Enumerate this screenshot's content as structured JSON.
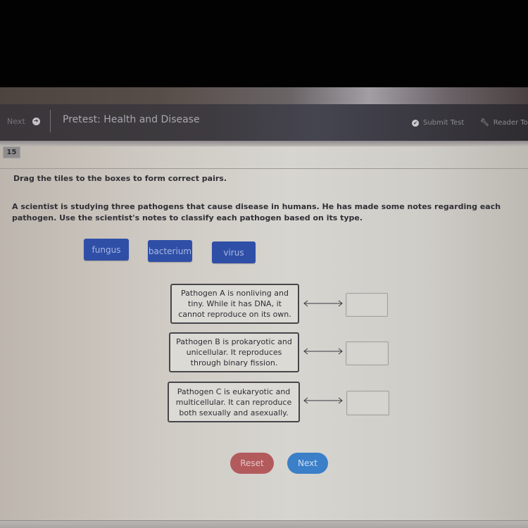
{
  "header": {
    "nav_next_label": "Next",
    "title": "Pretest: Health and Disease",
    "submit_label": "Submit Test",
    "reader_label": "Reader To"
  },
  "question": {
    "number": "15",
    "instruction": "Drag the tiles to the boxes to form correct pairs.",
    "prompt": "A scientist is studying three pathogens that cause disease in humans. He has made some notes regarding each pathogen. Use the scientist's notes to classify each pathogen based on its type."
  },
  "tiles": [
    {
      "label": "fungus"
    },
    {
      "label": "bacterium"
    },
    {
      "label": "virus"
    }
  ],
  "pairs": [
    {
      "note": "Pathogen A is nonliving and tiny. While it has DNA, it cannot reproduce on its own.",
      "answer": ""
    },
    {
      "note": "Pathogen B is prokaryotic and unicellular. It reproduces through binary fission.",
      "answer": ""
    },
    {
      "note": "Pathogen C is eukaryotic and multicellular. It can reproduce both sexually and asexually.",
      "answer": ""
    }
  ],
  "buttons": {
    "reset": "Reset",
    "next": "Next"
  },
  "colors": {
    "tile": "#2f4fa7",
    "reset": "#b35a5d",
    "next": "#3a7fc8",
    "topbar": "#3e3b40"
  }
}
